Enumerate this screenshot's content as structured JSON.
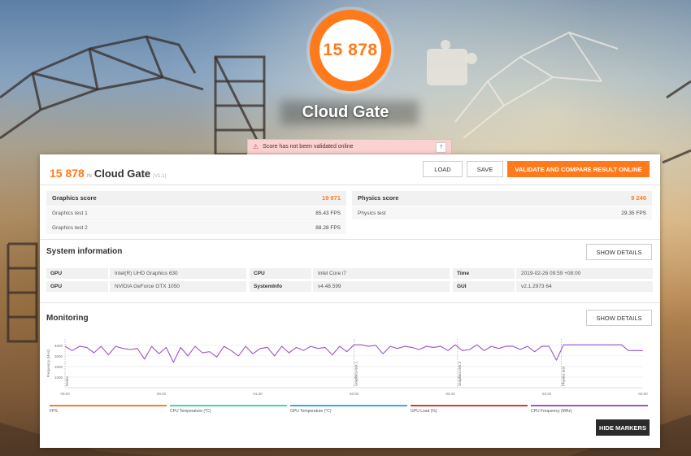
{
  "app": {
    "overall_score": "15 878",
    "benchmark_name": "Cloud Gate",
    "benchmark_version": "(V1.1)",
    "in_label": "IN"
  },
  "warning": {
    "text": "Score has not been validated online",
    "help": "?"
  },
  "toolbar": {
    "load_label": "LOAD",
    "save_label": "SAVE",
    "validate_label": "VALIDATE AND COMPARE RESULT ONLINE"
  },
  "scores": {
    "graphics": {
      "label": "Graphics score",
      "value": "19 971",
      "tests": [
        {
          "label": "Graphics test 1",
          "value": "85.43 FPS"
        },
        {
          "label": "Graphics test 2",
          "value": "88.28 FPS"
        }
      ]
    },
    "physics": {
      "label": "Physics score",
      "value": "9 246",
      "tests": [
        {
          "label": "Physics test",
          "value": "29.35 FPS"
        }
      ]
    }
  },
  "system": {
    "title": "System information",
    "show_details": "SHOW DETAILS",
    "rows": [
      [
        {
          "key": "GPU",
          "value": "Intel(R) UHD Graphics 630"
        },
        {
          "key": "CPU",
          "value": "Intel Core i7"
        },
        {
          "key": "Time",
          "value": "2019-02-26 09:59 +08:00"
        }
      ],
      [
        {
          "key": "GPU",
          "value": "NVIDIA GeForce GTX 1050"
        },
        {
          "key": "SystemInfo",
          "value": "v4.48.599"
        },
        {
          "key": "GUI",
          "value": "v2.1.2973 64"
        }
      ]
    ]
  },
  "monitoring": {
    "title": "Monitoring",
    "show_details": "SHOW DETAILS",
    "hide_markers": "HIDE MARKERS",
    "legend": [
      {
        "label": "FPS",
        "color": "#f0822a"
      },
      {
        "label": "CPU Temperature (°C)",
        "color": "#3fd6b4"
      },
      {
        "label": "GPU Temperature (°C)",
        "color": "#3aa9e0"
      },
      {
        "label": "GPU Load (%)",
        "color": "#d23a3a"
      },
      {
        "label": "CPU Frequency (MHz)",
        "color": "#9a55c8"
      }
    ]
  },
  "chart_data": {
    "type": "line",
    "ylabel": "Frequency (MHz)",
    "yticks": [
      "4000",
      "3000",
      "2000",
      "1000"
    ],
    "ylim": [
      0,
      4600
    ],
    "xticks": [
      "00:00",
      "00:40",
      "01:20",
      "02:00",
      "02:40",
      "03:20",
      "04:00"
    ],
    "xlim": [
      0,
      240
    ],
    "markers": [
      {
        "t": 0,
        "label": "Demo"
      },
      {
        "t": 120,
        "label": "Graphics test 1"
      },
      {
        "t": 163,
        "label": "Graphics test 2"
      },
      {
        "t": 206,
        "label": "Physics test"
      }
    ],
    "series": [
      {
        "name": "CPU Frequency (MHz)",
        "color": "#9a55c8",
        "x": [
          0,
          3,
          6,
          9,
          12,
          15,
          18,
          21,
          24,
          27,
          30,
          33,
          36,
          39,
          42,
          45,
          48,
          51,
          54,
          57,
          60,
          63,
          66,
          69,
          72,
          75,
          78,
          81,
          84,
          87,
          90,
          93,
          96,
          99,
          102,
          105,
          108,
          111,
          114,
          117,
          120,
          123,
          126,
          129,
          132,
          135,
          138,
          141,
          144,
          147,
          150,
          153,
          156,
          159,
          162,
          165,
          168,
          171,
          174,
          177,
          180,
          183,
          186,
          189,
          192,
          195,
          198,
          201,
          204,
          207,
          210,
          213,
          216,
          219,
          222,
          225,
          228,
          231,
          234,
          237,
          240
        ],
        "values": [
          3900,
          3500,
          3900,
          3800,
          3300,
          3900,
          3100,
          3900,
          3700,
          3600,
          3700,
          2700,
          3900,
          3200,
          3800,
          2400,
          3800,
          3000,
          3900,
          3300,
          3400,
          2900,
          3900,
          3500,
          3000,
          3900,
          3200,
          3700,
          3800,
          3000,
          3900,
          3300,
          3800,
          3500,
          3900,
          3700,
          3800,
          3100,
          3900,
          3400,
          4050,
          4050,
          3900,
          4000,
          3200,
          3900,
          3700,
          3900,
          3800,
          3600,
          3900,
          3800,
          3900,
          3500,
          4050,
          3500,
          3600,
          4050,
          3500,
          3900,
          3700,
          3900,
          3900,
          3600,
          3900,
          3400,
          3900,
          3900,
          2600,
          4050,
          4050,
          4050,
          4050,
          4050,
          4050,
          4050,
          4050,
          4050,
          3500,
          3500,
          3500
        ]
      }
    ]
  }
}
